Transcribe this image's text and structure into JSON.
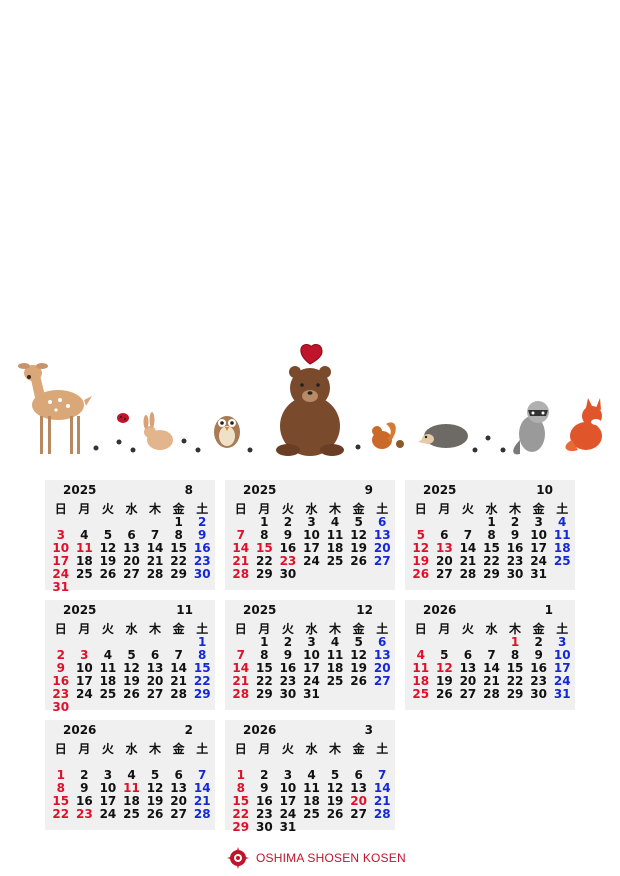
{
  "colors": {
    "sunday": "#e0102a",
    "saturday": "#1428d8",
    "cell_bg": "#f0f0f0",
    "brand": "#c0142a"
  },
  "illustration": {
    "animals": [
      "deer",
      "ladybug",
      "rabbit",
      "owl",
      "bear",
      "heart",
      "squirrel",
      "hedgehog",
      "raccoon",
      "fox",
      "paw-prints"
    ]
  },
  "weekdays": [
    "日",
    "月",
    "火",
    "水",
    "木",
    "金",
    "土"
  ],
  "calendars": [
    {
      "year": "2025",
      "month": "8",
      "weeks": [
        [
          "",
          "",
          "",
          "",
          "",
          "1",
          "2"
        ],
        [
          "3",
          "4",
          "5",
          "6",
          "7",
          "8",
          "9"
        ],
        [
          "10",
          "11",
          "12",
          "13",
          "14",
          "15",
          "16"
        ],
        [
          "17",
          "18",
          "19",
          "20",
          "21",
          "22",
          "23"
        ],
        [
          "24",
          "25",
          "26",
          "27",
          "28",
          "29",
          "30"
        ],
        [
          "31",
          "",
          "",
          "",
          "",
          "",
          ""
        ]
      ],
      "holidays": [
        "11"
      ]
    },
    {
      "year": "2025",
      "month": "9",
      "weeks": [
        [
          "",
          "1",
          "2",
          "3",
          "4",
          "5",
          "6"
        ],
        [
          "7",
          "8",
          "9",
          "10",
          "11",
          "12",
          "13"
        ],
        [
          "14",
          "15",
          "16",
          "17",
          "18",
          "19",
          "20"
        ],
        [
          "21",
          "22",
          "23",
          "24",
          "25",
          "26",
          "27"
        ],
        [
          "28",
          "29",
          "30",
          "",
          "",
          "",
          ""
        ]
      ],
      "holidays": [
        "15",
        "23"
      ]
    },
    {
      "year": "2025",
      "month": "10",
      "weeks": [
        [
          "",
          "",
          "",
          "1",
          "2",
          "3",
          "4"
        ],
        [
          "5",
          "6",
          "7",
          "8",
          "9",
          "10",
          "11"
        ],
        [
          "12",
          "13",
          "14",
          "15",
          "16",
          "17",
          "18"
        ],
        [
          "19",
          "20",
          "21",
          "22",
          "23",
          "24",
          "25"
        ],
        [
          "26",
          "27",
          "28",
          "29",
          "30",
          "31",
          ""
        ]
      ],
      "holidays": [
        "13"
      ]
    },
    {
      "year": "2025",
      "month": "11",
      "weeks": [
        [
          "",
          "",
          "",
          "",
          "",
          "",
          "1"
        ],
        [
          "2",
          "3",
          "4",
          "5",
          "6",
          "7",
          "8"
        ],
        [
          "9",
          "10",
          "11",
          "12",
          "13",
          "14",
          "15"
        ],
        [
          "16",
          "17",
          "18",
          "19",
          "20",
          "21",
          "22"
        ],
        [
          "23",
          "24",
          "25",
          "26",
          "27",
          "28",
          "29"
        ],
        [
          "30",
          "",
          "",
          "",
          "",
          "",
          ""
        ]
      ],
      "holidays": [
        "3"
      ]
    },
    {
      "year": "2025",
      "month": "12",
      "weeks": [
        [
          "",
          "1",
          "2",
          "3",
          "4",
          "5",
          "6"
        ],
        [
          "7",
          "8",
          "9",
          "10",
          "11",
          "12",
          "13"
        ],
        [
          "14",
          "15",
          "16",
          "17",
          "18",
          "19",
          "20"
        ],
        [
          "21",
          "22",
          "23",
          "24",
          "25",
          "26",
          "27"
        ],
        [
          "28",
          "29",
          "30",
          "31",
          "",
          "",
          ""
        ]
      ],
      "holidays": []
    },
    {
      "year": "2026",
      "month": "1",
      "weeks": [
        [
          "",
          "",
          "",
          "",
          "1",
          "2",
          "3"
        ],
        [
          "4",
          "5",
          "6",
          "7",
          "8",
          "9",
          "10"
        ],
        [
          "11",
          "12",
          "13",
          "14",
          "15",
          "16",
          "17"
        ],
        [
          "18",
          "19",
          "20",
          "21",
          "22",
          "23",
          "24"
        ],
        [
          "25",
          "26",
          "27",
          "28",
          "29",
          "30",
          "31"
        ]
      ],
      "holidays": [
        "1",
        "12"
      ]
    },
    {
      "year": "2026",
      "month": "2",
      "weeks": [
        [
          "",
          "",
          "",
          "",
          "",
          "",
          ""
        ],
        [
          "1",
          "2",
          "3",
          "4",
          "5",
          "6",
          "7"
        ],
        [
          "8",
          "9",
          "10",
          "11",
          "12",
          "13",
          "14"
        ],
        [
          "15",
          "16",
          "17",
          "18",
          "19",
          "20",
          "21"
        ],
        [
          "22",
          "23",
          "24",
          "25",
          "26",
          "27",
          "28"
        ]
      ],
      "holidays": [
        "11",
        "23"
      ]
    },
    {
      "year": "2026",
      "month": "3",
      "weeks": [
        [
          "",
          "",
          "",
          "",
          "",
          "",
          ""
        ],
        [
          "1",
          "2",
          "3",
          "4",
          "5",
          "6",
          "7"
        ],
        [
          "8",
          "9",
          "10",
          "11",
          "12",
          "13",
          "14"
        ],
        [
          "15",
          "16",
          "17",
          "18",
          "19",
          "20",
          "21"
        ],
        [
          "22",
          "23",
          "24",
          "25",
          "26",
          "27",
          "28"
        ],
        [
          "29",
          "30",
          "31",
          "",
          "",
          "",
          ""
        ]
      ],
      "holidays": [
        "20"
      ]
    }
  ],
  "footer": {
    "logo_text": "OSHIMA SHOSEN KOSEN"
  }
}
